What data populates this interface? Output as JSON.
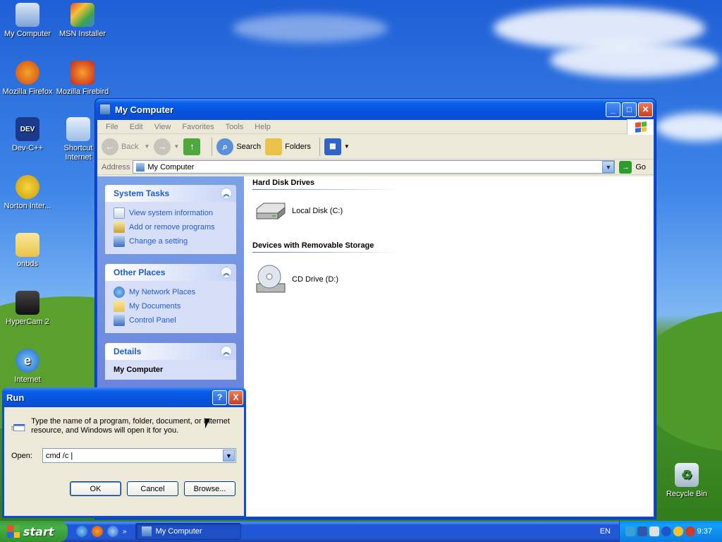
{
  "desktop": {
    "icons": [
      {
        "label": "My Computer"
      },
      {
        "label": "MSN Installer"
      },
      {
        "label": "Mozilla Firefox"
      },
      {
        "label": "Mozilla Firebird"
      },
      {
        "label": "Dev-C++"
      },
      {
        "label": "Shortcut Internet"
      },
      {
        "label": "Norton Inter..."
      },
      {
        "label": "onbds"
      },
      {
        "label": "HyperCam 2"
      },
      {
        "label": "Internet Explorer"
      },
      {
        "label": "Recycle Bin"
      }
    ]
  },
  "window": {
    "title": "My Computer",
    "menu": [
      "File",
      "Edit",
      "View",
      "Favorites",
      "Tools",
      "Help"
    ],
    "toolbar": {
      "back": "Back",
      "search": "Search",
      "folders": "Folders"
    },
    "address": {
      "label": "Address",
      "value": "My Computer",
      "go": "Go"
    },
    "taskpane": {
      "system_tasks": {
        "title": "System Tasks",
        "links": [
          "View system information",
          "Add or remove programs",
          "Change a setting"
        ]
      },
      "other_places": {
        "title": "Other Places",
        "links": [
          "My Network Places",
          "My Documents",
          "Control Panel"
        ]
      },
      "details": {
        "title": "Details",
        "item": "My Computer"
      }
    },
    "groups": [
      {
        "title": "Hard Disk Drives",
        "items": [
          "Local Disk (C:)"
        ]
      },
      {
        "title": "Devices with Removable Storage",
        "items": [
          "CD Drive (D:)"
        ]
      }
    ]
  },
  "run_dialog": {
    "title": "Run",
    "help": "?",
    "close": "X",
    "description": "Type the name of a program, folder, document, or Internet resource, and Windows will open it for you.",
    "open_label": "Open:",
    "open_value": "cmd /c |",
    "ok": "OK",
    "cancel": "Cancel",
    "browse": "Browse..."
  },
  "taskbar": {
    "start": "start",
    "task": "My Computer",
    "lang": "EN",
    "clock": "9:37"
  }
}
